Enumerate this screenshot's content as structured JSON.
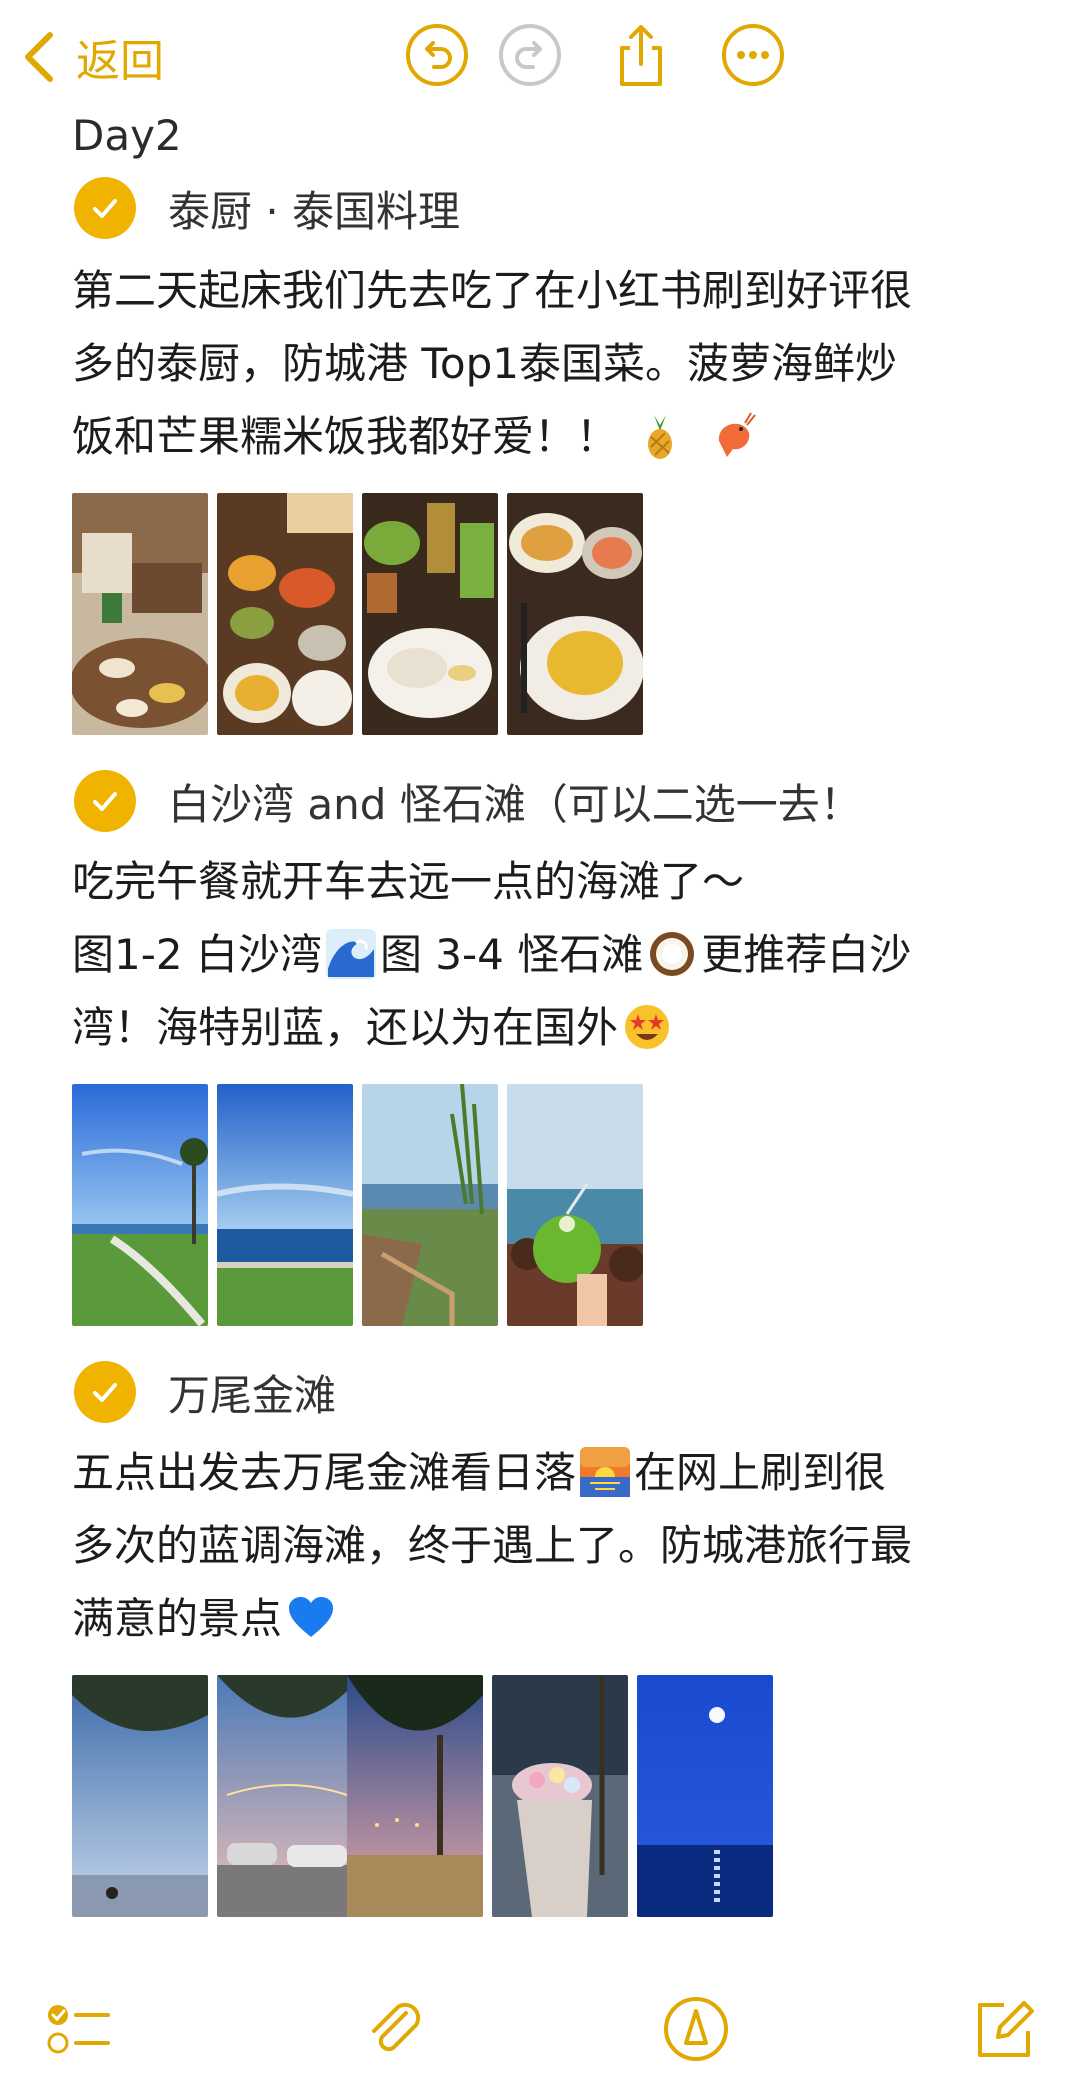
{
  "nav": {
    "back_label": "返回",
    "accent": "#e0a800"
  },
  "note": {
    "day_title": "Day2",
    "sections": [
      {
        "title": "泰厨 · 泰国料理",
        "lines": [
          "第二天起床我们先去吃了在小红书刷到好评很",
          "多的泰厨，防城港 Top1泰国菜。菠萝海鲜炒",
          "饭和芒果糯米饭我都好爱！！"
        ],
        "emojis": [
          "pineapple-emoji",
          "shrimp-emoji"
        ],
        "photos": [
          "restaurant-interior-photo",
          "thai-dishes-photo",
          "drinks-and-rice-photo",
          "curry-dish-photo"
        ]
      },
      {
        "title": "白沙湾 and 怪石滩（可以二选一去！",
        "lines": [
          "吃完午餐就开车去远一点的海滩了～",
          "图1-2 白沙湾",
          "图 3-4 怪石滩",
          "更推荐白沙",
          "湾！海特别蓝，还以为在国外"
        ],
        "emojis": [
          "wave-emoji",
          "coconut-emoji",
          "star-struck-emoji"
        ],
        "photos": [
          "baishawan-lawn-photo",
          "baishawan-sea-photo",
          "guaishitan-path-photo",
          "coconut-beach-photo"
        ]
      },
      {
        "title": "万尾金滩",
        "lines": [
          "五点出发去万尾金滩看日落",
          "在网上刷到很",
          "多次的蓝调海滩，终于遇上了。防城港旅行最",
          "满意的景点"
        ],
        "emojis": [
          "sunrise-emoji",
          "blue-heart-emoji"
        ],
        "photos": [
          "beach-scooter-photo",
          "beach-cars-photo",
          "beach-lights-photo",
          "bouquet-photo",
          "moonlight-sea-photo"
        ]
      }
    ]
  },
  "colors": {
    "accent": "#f0b400",
    "text": "#1c1c1e",
    "disabled_icon": "#c8c8c8"
  },
  "toolbar": {
    "icons": [
      "checklist-icon",
      "attachment-icon",
      "markup-pen-icon",
      "compose-icon"
    ]
  }
}
